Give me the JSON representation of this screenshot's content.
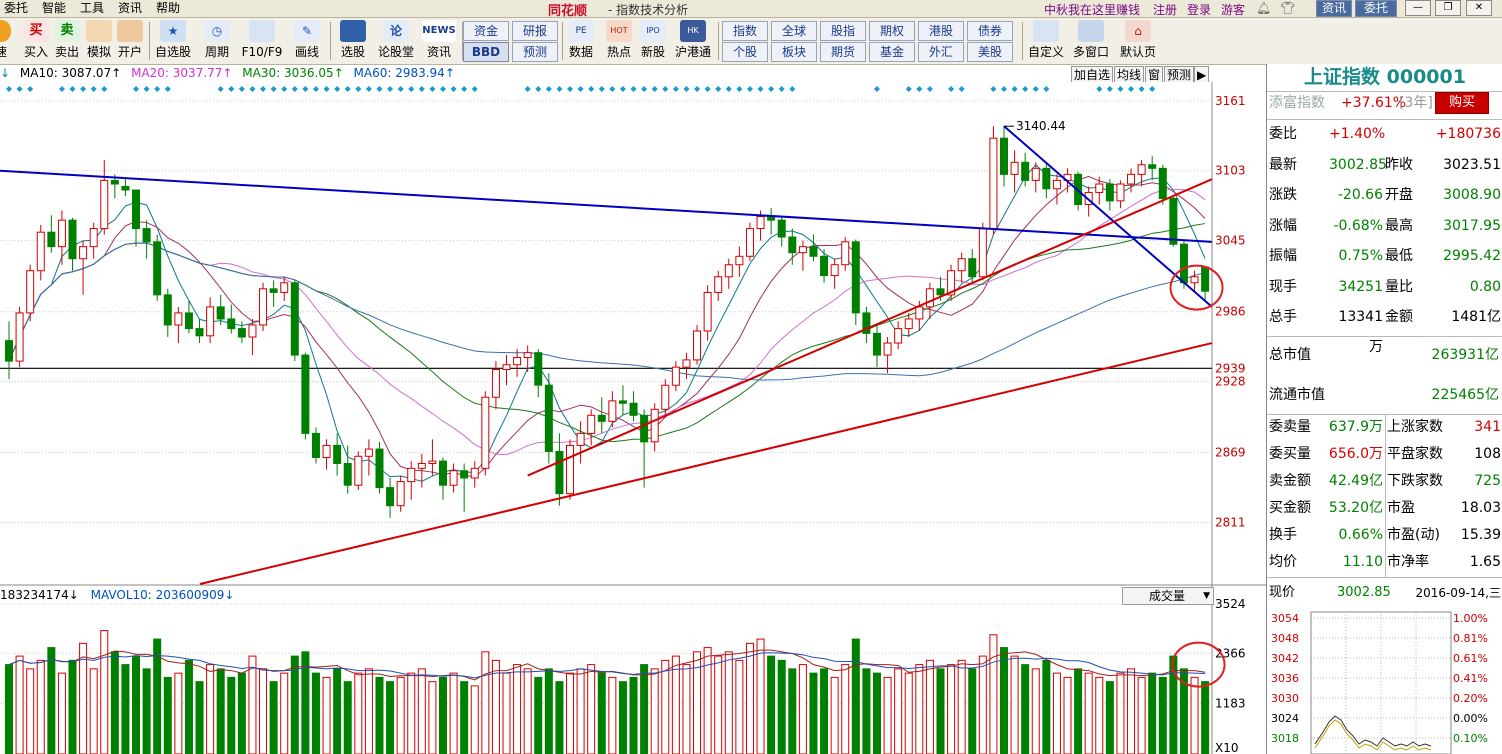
{
  "menu": {
    "items": [
      "委托",
      "智能",
      "工具",
      "资讯",
      "帮助"
    ],
    "app_name": "同花顺",
    "window_title": "- 指数技术分析",
    "promo": "中秋我在这里赚钱",
    "register": "注册",
    "login": "登录",
    "guest": "游客",
    "info_btn": "资讯",
    "trade_btn": "委托"
  },
  "toolbar": {
    "left": [
      {
        "label": "速",
        "icon": "orange"
      },
      {
        "label": "买入",
        "icon": "buy"
      },
      {
        "label": "卖出",
        "icon": "sell"
      },
      {
        "label": "模拟",
        "icon": "sim"
      },
      {
        "label": "开户",
        "icon": "open"
      },
      {
        "label": "自选股",
        "icon": "fav"
      },
      {
        "label": "周期",
        "icon": "clock"
      },
      {
        "label": "F10/F9",
        "icon": "f10"
      },
      {
        "label": "画线",
        "icon": "pen"
      },
      {
        "label": "选股",
        "icon": "pick"
      },
      {
        "label": "论股堂",
        "icon": "forum"
      },
      {
        "label": "资讯",
        "icon": "news"
      }
    ],
    "news_icon_text": "NEWS",
    "small_a": [
      "资金",
      "研报",
      "BBD",
      "预测"
    ],
    "mid": [
      {
        "label": "数据",
        "icon_text": "PE"
      },
      {
        "label": "热点",
        "icon_text": "HOT"
      },
      {
        "label": "新股",
        "icon_text": "IPO"
      },
      {
        "label": "沪港通",
        "icon_text": "HK"
      }
    ],
    "small_b": [
      "指数",
      "全球",
      "股指",
      "期权",
      "港股",
      "债券",
      "个股",
      "板块",
      "期货",
      "基金",
      "外汇",
      "美股"
    ],
    "right": [
      {
        "label": "自定义"
      },
      {
        "label": "多窗口"
      },
      {
        "label": "默认页"
      }
    ]
  },
  "ma_bar": [
    {
      "text": "MA10: 3087.07↑",
      "color": "#000000"
    },
    {
      "text": "MA20: 3037.77↑",
      "color": "#d030d0"
    },
    {
      "text": "MA30: 3036.05↑",
      "color": "#008000"
    },
    {
      "text": "MA60: 2983.94↑",
      "color": "#0050c0"
    }
  ],
  "ma_prefix": "↓",
  "chart_buttons": [
    "加自选",
    "均线",
    "窗",
    "预测",
    "▶"
  ],
  "price_axis": [
    "3161",
    "3103",
    "3045",
    "2986",
    "2939",
    "2928",
    "2869",
    "2811"
  ],
  "peak_label": "3140.44",
  "volume_bar": {
    "vol": "183234174↓",
    "mavol10": "MAVOL10: 203600909↓",
    "dropdown": "成交量"
  },
  "volume_axis": [
    "3524",
    "2366",
    "1183",
    "X10"
  ],
  "panel": {
    "title": "上证指数 000001",
    "promo_label": "添富指数",
    "promo_value": "+37.61%",
    "promo_period": "[3年]",
    "buy": "购买",
    "rows": [
      {
        "l1": "委比",
        "v1": "+1.40%",
        "c1": "red",
        "l2": "",
        "v2": "+180736",
        "c2": "red"
      },
      {
        "l1": "最新",
        "v1": "3002.85",
        "c1": "grn",
        "l2": "昨收",
        "v2": "3023.51",
        "c2": "blk"
      },
      {
        "l1": "涨跌",
        "v1": "-20.66",
        "c1": "grn",
        "l2": "开盘",
        "v2": "3008.90",
        "c2": "grn"
      },
      {
        "l1": "涨幅",
        "v1": "-0.68%",
        "c1": "grn",
        "l2": "最高",
        "v2": "3017.95",
        "c2": "grn"
      },
      {
        "l1": "振幅",
        "v1": "0.75%",
        "c1": "grn",
        "l2": "最低",
        "v2": "2995.42",
        "c2": "grn"
      },
      {
        "l1": "现手",
        "v1": "34251",
        "c1": "grn",
        "l2": "量比",
        "v2": "0.80",
        "c2": "grn"
      },
      {
        "l1": "总手",
        "v1": "13341万",
        "c1": "blk",
        "l2": "金额",
        "v2": "1481亿",
        "c2": "blk"
      }
    ],
    "mcap_label": "总市值",
    "mcap_value": "263931亿",
    "float_label": "流通市值",
    "float_value": "225465亿",
    "grid": [
      {
        "l1": "委卖量",
        "v1": "637.9万",
        "c1": "grn",
        "l2": "上涨家数",
        "v2": "341",
        "c2": "red"
      },
      {
        "l1": "委买量",
        "v1": "656.0万",
        "c1": "red",
        "l2": "平盘家数",
        "v2": "108",
        "c2": "blk"
      },
      {
        "l1": "卖金额",
        "v1": "42.49亿",
        "c1": "grn",
        "l2": "下跌家数",
        "v2": "725",
        "c2": "grn"
      },
      {
        "l1": "买金额",
        "v1": "53.20亿",
        "c1": "grn",
        "l2": "市盈",
        "v2": "18.03",
        "c2": "blk"
      },
      {
        "l1": "换手",
        "v1": "0.66%",
        "c1": "grn",
        "l2": "市盈(动)",
        "v2": "15.39",
        "c2": "blk"
      },
      {
        "l1": "均价",
        "v1": "11.10",
        "c1": "grn",
        "l2": "市净率",
        "v2": "1.65",
        "c2": "blk"
      }
    ],
    "now_label": "现价",
    "now_value": "3002.85",
    "date": "2016-09-14,三",
    "mini_left": [
      "3054",
      "3048",
      "3042",
      "3036",
      "3030",
      "3024",
      "3018"
    ],
    "mini_right": [
      "1.00%",
      "0.81%",
      "0.61%",
      "0.41%",
      "0.20%",
      "0.00%",
      "0.10%"
    ]
  },
  "colors": {
    "up": "#d40000",
    "down": "#008000",
    "trend_blue": "#0000c0",
    "trend_red": "#d40000"
  },
  "chart_data": {
    "type": "candlestick",
    "title": "上证指数 000001",
    "ylim": [
      2760,
      3175
    ],
    "ohlc": [
      [
        2962,
        2978,
        2930,
        2945
      ],
      [
        2945,
        2990,
        2940,
        2985
      ],
      [
        2985,
        3025,
        2978,
        3020
      ],
      [
        3020,
        3058,
        3012,
        3052
      ],
      [
        3052,
        3066,
        3035,
        3040
      ],
      [
        3040,
        3070,
        3025,
        3062
      ],
      [
        3062,
        3064,
        3020,
        3030
      ],
      [
        3030,
        3045,
        3000,
        3040
      ],
      [
        3040,
        3060,
        3030,
        3055
      ],
      [
        3055,
        3112,
        3050,
        3095
      ],
      [
        3095,
        3100,
        3080,
        3092
      ],
      [
        3090,
        3096,
        3082,
        3087
      ],
      [
        3087,
        3060,
        3040,
        3055
      ],
      [
        3055,
        3062,
        3030,
        3044
      ],
      [
        3044,
        3050,
        2995,
        3000
      ],
      [
        3000,
        3005,
        2965,
        2975
      ],
      [
        2975,
        2990,
        2960,
        2985
      ],
      [
        2985,
        2995,
        2968,
        2972
      ],
      [
        2972,
        2980,
        2960,
        2966
      ],
      [
        2966,
        2998,
        2960,
        2990
      ],
      [
        2990,
        3000,
        2975,
        2980
      ],
      [
        2980,
        2992,
        2968,
        2972
      ],
      [
        2972,
        2978,
        2960,
        2965
      ],
      [
        2965,
        2980,
        2950,
        2975
      ],
      [
        2975,
        3010,
        2970,
        3005
      ],
      [
        3005,
        3012,
        2990,
        3002
      ],
      [
        3002,
        3015,
        2995,
        3010
      ],
      [
        3010,
        3012,
        2945,
        2950
      ],
      [
        2950,
        2952,
        2880,
        2885
      ],
      [
        2885,
        2890,
        2860,
        2865
      ],
      [
        2865,
        2880,
        2855,
        2875
      ],
      [
        2875,
        2885,
        2850,
        2860
      ],
      [
        2860,
        2875,
        2835,
        2842
      ],
      [
        2842,
        2870,
        2838,
        2866
      ],
      [
        2866,
        2880,
        2850,
        2872
      ],
      [
        2872,
        2878,
        2835,
        2840
      ],
      [
        2840,
        2848,
        2815,
        2825
      ],
      [
        2825,
        2850,
        2820,
        2845
      ],
      [
        2845,
        2862,
        2830,
        2856
      ],
      [
        2856,
        2868,
        2840,
        2860
      ],
      [
        2860,
        2880,
        2850,
        2862
      ],
      [
        2862,
        2865,
        2830,
        2842
      ],
      [
        2842,
        2860,
        2836,
        2854
      ],
      [
        2854,
        2860,
        2820,
        2848
      ],
      [
        2848,
        2862,
        2840,
        2856
      ],
      [
        2856,
        2920,
        2850,
        2915
      ],
      [
        2915,
        2945,
        2905,
        2938
      ],
      [
        2938,
        2950,
        2925,
        2942
      ],
      [
        2942,
        2955,
        2932,
        2948
      ],
      [
        2948,
        2958,
        2936,
        2952
      ],
      [
        2952,
        2955,
        2915,
        2925
      ],
      [
        2925,
        2935,
        2860,
        2870
      ],
      [
        2870,
        2885,
        2825,
        2835
      ],
      [
        2835,
        2880,
        2830,
        2875
      ],
      [
        2875,
        2895,
        2860,
        2885
      ],
      [
        2885,
        2905,
        2875,
        2900
      ],
      [
        2900,
        2915,
        2885,
        2895
      ],
      [
        2895,
        2920,
        2890,
        2912
      ],
      [
        2912,
        2925,
        2900,
        2910
      ],
      [
        2910,
        2920,
        2895,
        2900
      ],
      [
        2900,
        2905,
        2840,
        2878
      ],
      [
        2878,
        2910,
        2870,
        2905
      ],
      [
        2905,
        2930,
        2900,
        2925
      ],
      [
        2925,
        2945,
        2920,
        2940
      ],
      [
        2940,
        2952,
        2930,
        2946
      ],
      [
        2946,
        2975,
        2942,
        2970
      ],
      [
        2970,
        3008,
        2962,
        3002
      ],
      [
        3002,
        3020,
        2995,
        3015
      ],
      [
        3015,
        3030,
        3005,
        3025
      ],
      [
        3025,
        3040,
        3015,
        3032
      ],
      [
        3032,
        3060,
        3028,
        3055
      ],
      [
        3055,
        3070,
        3045,
        3065
      ],
      [
        3065,
        3072,
        3050,
        3062
      ],
      [
        3062,
        3065,
        3040,
        3048
      ],
      [
        3048,
        3055,
        3025,
        3035
      ],
      [
        3035,
        3045,
        3020,
        3040
      ],
      [
        3040,
        3050,
        3028,
        3032
      ],
      [
        3032,
        3038,
        3010,
        3016
      ],
      [
        3016,
        3030,
        3005,
        3025
      ],
      [
        3025,
        3048,
        3020,
        3044
      ],
      [
        3044,
        3046,
        2975,
        2985
      ],
      [
        2985,
        2990,
        2960,
        2968
      ],
      [
        2968,
        2975,
        2940,
        2950
      ],
      [
        2950,
        2965,
        2935,
        2960
      ],
      [
        2960,
        2978,
        2955,
        2972
      ],
      [
        2972,
        2985,
        2965,
        2980
      ],
      [
        2980,
        2995,
        2970,
        2990
      ],
      [
        2990,
        3010,
        2980,
        3005
      ],
      [
        3005,
        3015,
        2995,
        3000
      ],
      [
        3000,
        3025,
        2995,
        3020
      ],
      [
        3020,
        3035,
        3010,
        3030
      ],
      [
        3030,
        3038,
        3010,
        3015
      ],
      [
        3015,
        3060,
        3012,
        3055
      ],
      [
        3055,
        3140,
        3050,
        3130
      ],
      [
        3130,
        3140,
        3090,
        3100
      ],
      [
        3100,
        3120,
        3085,
        3110
      ],
      [
        3110,
        3118,
        3090,
        3095
      ],
      [
        3095,
        3110,
        3085,
        3105
      ],
      [
        3105,
        3110,
        3080,
        3088
      ],
      [
        3088,
        3100,
        3075,
        3095
      ],
      [
        3095,
        3105,
        3085,
        3100
      ],
      [
        3100,
        3102,
        3070,
        3075
      ],
      [
        3075,
        3090,
        3065,
        3085
      ],
      [
        3085,
        3098,
        3075,
        3092
      ],
      [
        3092,
        3096,
        3070,
        3078
      ],
      [
        3078,
        3095,
        3072,
        3092
      ],
      [
        3092,
        3105,
        3085,
        3100
      ],
      [
        3100,
        3112,
        3090,
        3108
      ],
      [
        3108,
        3115,
        3095,
        3105
      ],
      [
        3105,
        3108,
        3075,
        3080
      ],
      [
        3080,
        3082,
        3040,
        3042
      ],
      [
        3042,
        3045,
        3005,
        3010
      ],
      [
        3010,
        3020,
        3002,
        3015
      ],
      [
        3023,
        3018,
        2995,
        3003
      ]
    ],
    "volume": [
      2100,
      2300,
      2000,
      2200,
      2500,
      1900,
      2200,
      2600,
      2000,
      2900,
      2400,
      2100,
      2300,
      2000,
      2700,
      1800,
      1900,
      2200,
      1700,
      2100,
      2000,
      1800,
      1900,
      2300,
      2000,
      1700,
      1900,
      2300,
      2400,
      1900,
      1800,
      2000,
      1700,
      1900,
      2000,
      1800,
      1700,
      1800,
      1900,
      2000,
      1700,
      1800,
      1900,
      1700,
      1600,
      2400,
      2200,
      1900,
      2100,
      2000,
      1800,
      2000,
      1700,
      1900,
      2000,
      2100,
      1900,
      1800,
      1700,
      1800,
      2100,
      2000,
      2200,
      2300,
      2100,
      2400,
      2500,
      2300,
      2400,
      2200,
      2600,
      2700,
      2300,
      2200,
      2000,
      2100,
      1900,
      2000,
      1800,
      2100,
      2700,
      2000,
      1900,
      1800,
      2000,
      1900,
      2100,
      2200,
      2000,
      2100,
      2200,
      2000,
      2300,
      2800,
      2500,
      2300,
      2100,
      2000,
      2200,
      1900,
      1800,
      2000,
      1900,
      1800,
      1700,
      1900,
      2000,
      1800,
      1900,
      1800,
      2300,
      2000,
      1800,
      1700
    ],
    "volume_ylim": [
      0,
      3524
    ]
  }
}
